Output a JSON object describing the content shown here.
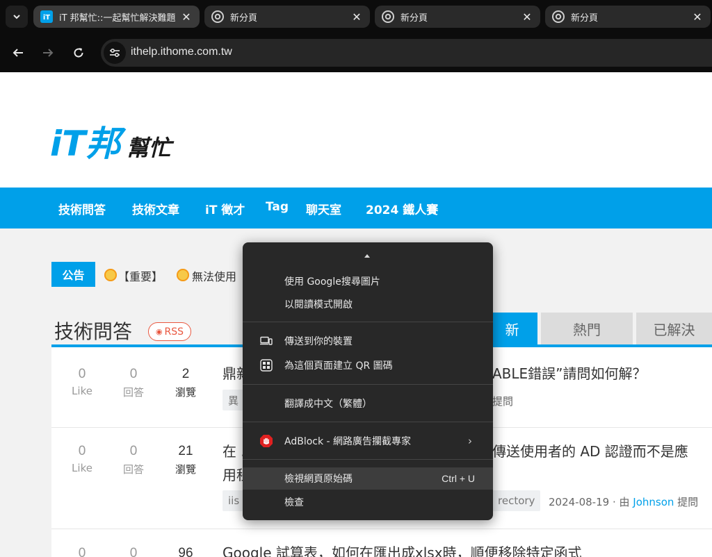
{
  "browser": {
    "tabs": [
      {
        "title": "iT 邦幫忙::一起幫忙解決難題",
        "active": true
      },
      {
        "title": "新分頁",
        "active": false
      },
      {
        "title": "新分頁",
        "active": false
      },
      {
        "title": "新分頁",
        "active": false
      }
    ],
    "url": "ithelp.ithome.com.tw"
  },
  "site": {
    "logo_text": "iT邦幫忙",
    "nav": [
      "技術問答",
      "技術文章",
      "iT 徵才",
      "Tag",
      "聊天室",
      "2024 鐵人賽"
    ],
    "announcement": {
      "badge": "公告",
      "text_prefix": "【重要】",
      "text": "無法使用"
    },
    "section": {
      "title": "技術問答",
      "rss": "RSS",
      "tabs": [
        "新",
        "熱門",
        "已解決"
      ]
    }
  },
  "questions": [
    {
      "likes": "0",
      "like_label": "Like",
      "answers": "0",
      "answer_label": "回答",
      "views": "2",
      "view_label": "瀏覽",
      "title_left": "鼎新",
      "title_right": "ABLE錯誤”請問如何解？",
      "tag_left": "異",
      "meta_right": "提問"
    },
    {
      "likes": "0",
      "like_label": "Like",
      "answers": "0",
      "answer_label": "回答",
      "views": "21",
      "view_label": "瀏覽",
      "title_left": "在 .",
      "title_left2": "用程",
      "title_right": "傳送使用者的 AD 認證而不是應",
      "tag_left": "iis",
      "tag_right": "rectory",
      "meta_date": "2024-08-19 · 由",
      "meta_author": "Johnson",
      "meta_suffix": "提問"
    },
    {
      "likes": "0",
      "answers": "0",
      "views": "96",
      "title": "Google 試算表，如何在匯出成xlsx時，順便移除特定函式"
    }
  ],
  "context_menu": {
    "items": [
      {
        "label": "使用 Google搜尋圖片",
        "icon": ""
      },
      {
        "label": "以閱讀模式開啟",
        "icon": ""
      },
      {
        "label": "傳送到你的裝置",
        "icon": "devices-icon"
      },
      {
        "label": "為這個頁面建立 QR 圖碼",
        "icon": "qr-code-icon"
      },
      {
        "label": "翻譯成中文（繁體）",
        "icon": ""
      },
      {
        "label": "AdBlock - 網路廣告攔截專家",
        "icon": "adblock-icon"
      },
      {
        "label": "檢視網頁原始碼",
        "shortcut": "Ctrl + U",
        "highlighted": true
      },
      {
        "label": "檢查",
        "icon": ""
      }
    ]
  },
  "colors": {
    "brand_blue": "#00a0e9",
    "chrome_bg": "#0c0c0c",
    "menu_bg": "#282828",
    "rss_red": "#e9573f"
  }
}
